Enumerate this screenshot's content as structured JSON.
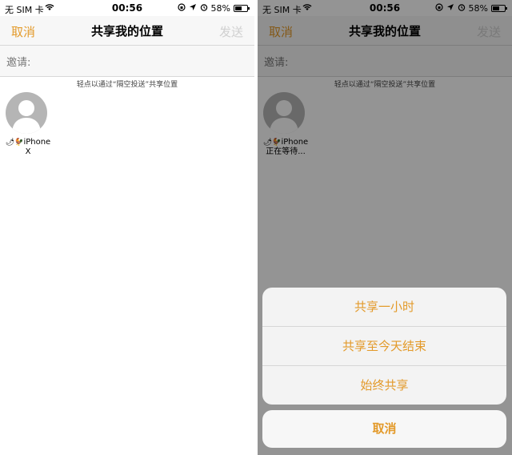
{
  "status": {
    "carrier": "无 SIM 卡",
    "time": "00:56",
    "battery": "58%",
    "battery_level": 0.58
  },
  "nav": {
    "cancel": "取消",
    "title": "共享我的位置",
    "send": "发送"
  },
  "invite": {
    "label": "邀请:"
  },
  "hint": "轻点以通过“隔空投送”共享位置",
  "contact": {
    "name_left": "iPhone X",
    "name_right": "iPhone",
    "status_waiting": "正在等待..."
  },
  "sheet": {
    "options": [
      "共享一小时",
      "共享至今天结束",
      "始终共享"
    ],
    "cancel": "取消"
  },
  "colors": {
    "accent": "#e39a2a"
  }
}
